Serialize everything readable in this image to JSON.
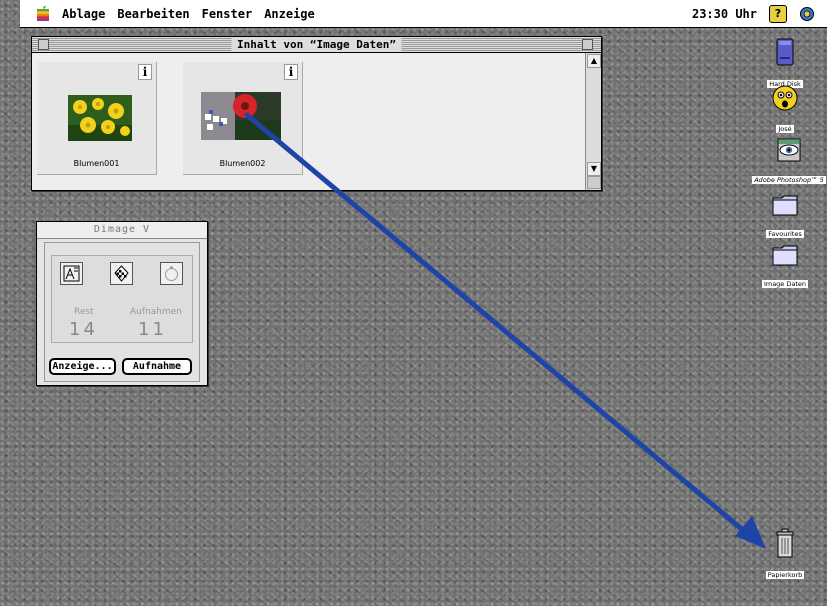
{
  "menubar": {
    "items": [
      "Ablage",
      "Bearbeiten",
      "Fenster",
      "Anzeige"
    ],
    "clock": "23:30 Uhr"
  },
  "finder_window": {
    "title": "Inhalt von “Image Daten”",
    "info_label": "i",
    "files": [
      {
        "name": "Blumen001",
        "icon": "yellow-flowers-thumbnail"
      },
      {
        "name": "Blumen002",
        "icon": "red-flower-thumbnail"
      }
    ]
  },
  "dimage": {
    "title": "Dimage V",
    "rest_label": "Rest",
    "rest_value": "14",
    "shots_label": "Aufnahmen",
    "shots_value": "11",
    "view_button": "Anzeige...",
    "capture_button": "Aufnahme"
  },
  "desktop_icons": [
    {
      "label": "Hard Disk",
      "icon": "hard-disk-icon"
    },
    {
      "label": "José",
      "icon": "user-face-icon"
    },
    {
      "label": "Adobe Photoshop™ 5",
      "icon": "photoshop-eye-icon"
    },
    {
      "label": "Favourites",
      "icon": "folder-icon"
    },
    {
      "label": "Image Daten",
      "icon": "folder-icon"
    },
    {
      "label": "Papierkorb",
      "icon": "trash-icon"
    }
  ],
  "colors": {
    "arrow": "#1f44a8",
    "desktop": "#707070",
    "menubar": "#ffffff"
  }
}
